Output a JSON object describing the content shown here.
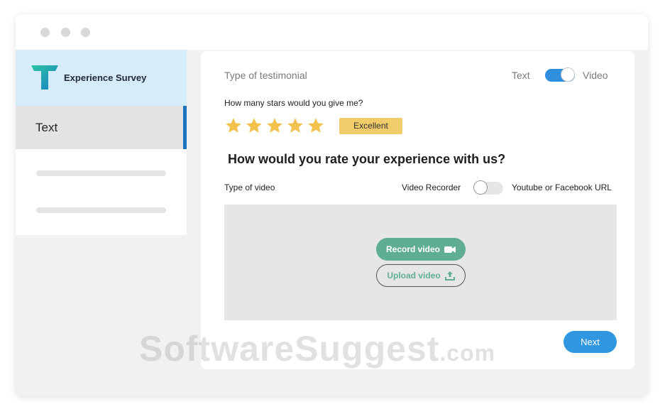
{
  "app": {
    "name": "Experience Survey"
  },
  "sidebar": {
    "items": [
      {
        "label": "Text",
        "active": true
      }
    ]
  },
  "form": {
    "type_label": "Type of testimonial",
    "toggle_left": "Text",
    "toggle_right": "Video",
    "toggle_state": "Video",
    "stars_question": "How many stars would you give me?",
    "rating": 5,
    "rating_max": 5,
    "rating_badge": "Excellent",
    "question": "How would you rate your experience with us?",
    "video_type_label": "Type of video",
    "video_option_left": "Video Recorder",
    "video_option_right": "Youtube or Facebook URL",
    "video_option_state": "Video Recorder",
    "record_button": "Record video",
    "upload_button": "Upload video",
    "next_button": "Next"
  },
  "watermark": {
    "main": "SoftwareSuggest",
    "suffix": ".com"
  },
  "colors": {
    "accent_blue": "#2f96e0",
    "accent_green": "#5fae94",
    "star_gold": "#f2c14e",
    "badge_yellow": "#f0cc6a",
    "brand_bg": "#d6ecf9"
  },
  "icons": {
    "record": "video-camera-icon",
    "upload": "upload-icon",
    "rating": "star-icon"
  }
}
